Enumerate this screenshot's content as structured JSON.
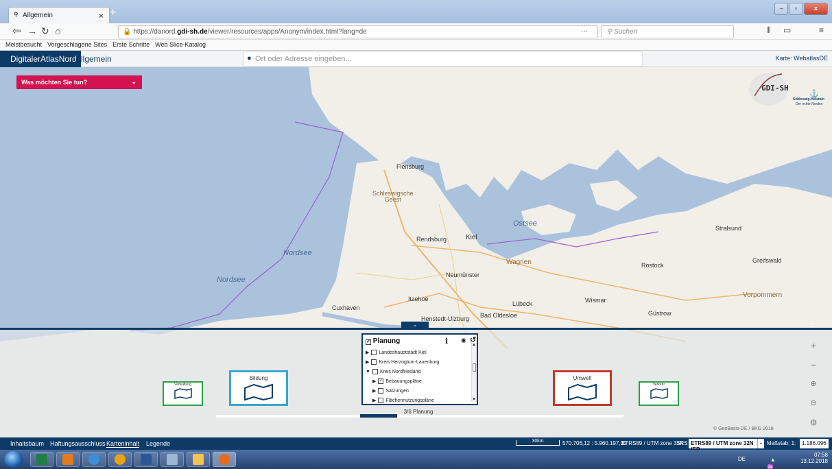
{
  "browser": {
    "tab_title": "Allgemein",
    "tab_close": "×",
    "new_tab": "+",
    "url_prefix": "https://danord.",
    "url_domain": "gdi-sh.de",
    "url_suffix": "/viewer/resources/apps/Anonym/index.html?lang=de",
    "url_menu": "··· ",
    "search_placeholder": "Suchen",
    "bookmarks": [
      "Meistbesucht",
      "Vorgeschlagene Sites",
      "Erste Schritte",
      "Web Slice-Katalog"
    ],
    "window_controls": [
      "–",
      "▫",
      "x"
    ]
  },
  "app": {
    "brand": "DigitalerAtlasNord",
    "subtitle": "Allgemein",
    "address_placeholder": "Ort oder Adresse eingeben...",
    "map_selector": "Karte: WebatlasDE",
    "what_button": "Was möchten Sie tun?",
    "logo_text": "GDI-SH",
    "logo_sub1": "Schleswig-Holstein",
    "logo_sub2": "Der echte Norden"
  },
  "map": {
    "seas": [
      "Nordsee",
      "Nordsee",
      "Ostsee"
    ],
    "region_label_1": "Schleswigsche",
    "region_label_2": "Geest",
    "cities": [
      "Flensburg",
      "Kiel",
      "Rendsburg",
      "Neumünster",
      "Itzehoe",
      "Lübeck",
      "Wismar",
      "Rostock",
      "Stralsund",
      "Greifswald",
      "Güstrow",
      "Cuxhaven",
      "Bad Oldesloe",
      "Henstedt-Ulzburg",
      "Wagrien",
      "Vorpommern"
    ]
  },
  "panel": {
    "categories": [
      {
        "label": "Verwaltung",
        "color": "#2e9e47"
      },
      {
        "label": "Bildung",
        "color": "#3aa6c9"
      },
      {
        "label": "Umwelt",
        "color": "#c0392b"
      },
      {
        "label": "Verkehr",
        "color": "#2e9e47"
      }
    ],
    "layer_title": "Planung",
    "layers": [
      {
        "label": "Landeshauptstadt Kiel",
        "checked": false,
        "indent": 0,
        "open": false
      },
      {
        "label": "Kreis Herzogtum-Lauenburg",
        "checked": false,
        "indent": 0,
        "open": false
      },
      {
        "label": "Kreis Nordfriesland",
        "checked": false,
        "indent": 0,
        "open": true
      },
      {
        "label": "Bebauungspläne",
        "checked": true,
        "indent": 1,
        "open": false
      },
      {
        "label": "Satzungen",
        "checked": false,
        "indent": 1,
        "open": false
      },
      {
        "label": "Flächennutzungspläne",
        "checked": false,
        "indent": 1,
        "open": false
      }
    ],
    "progress_label": "3/6 Planung",
    "progress_fraction": 0.5,
    "attribution": "© GeoBasis-DE / BKG 2018"
  },
  "footer": {
    "tabs": [
      "Inhaltsbaum",
      "Haftungsausschluss",
      "Karteninhalt",
      "Legende"
    ],
    "active_tab": "Karteninhalt",
    "scale_bar": "30km",
    "coordinates": "570.706,12 : 5.960.197,30",
    "crs": "ETRS89 / UTM zone 32N",
    "srs_label": "SRS",
    "srs_value": "ETRS89 / UTM zone 32N (EP...",
    "massstab_label": "Maßstab: 1:",
    "massstab_value": "1.186.096"
  },
  "taskbar": {
    "tray_lang": "DE",
    "time": "07:58",
    "date": "13.12.2018"
  },
  "colors": {
    "brand": "#0d3b66",
    "accent": "#d31350",
    "water": "#aac2dc",
    "land": "#f2efe9"
  }
}
